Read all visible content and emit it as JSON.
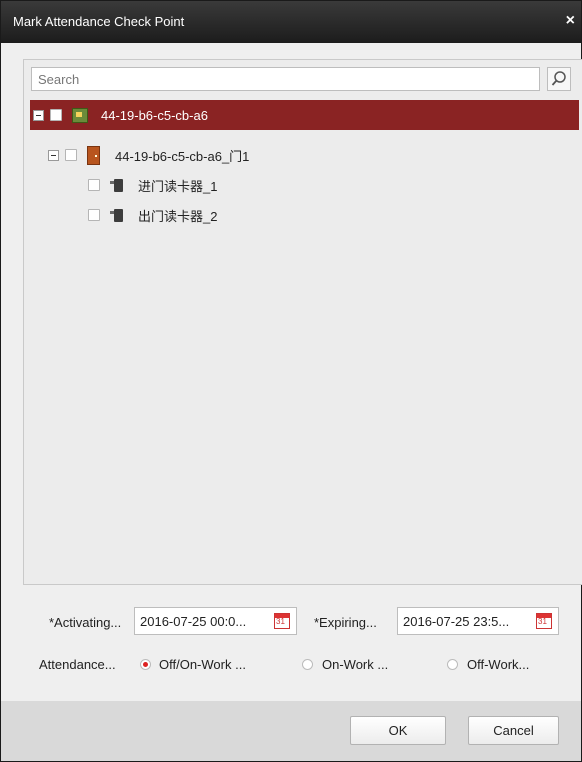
{
  "dialog": {
    "title": "Mark Attendance Check Point",
    "close_symbol": "×"
  },
  "search": {
    "placeholder": "Search",
    "icon": "search-icon"
  },
  "tree": {
    "device": {
      "label": "44-19-b6-c5-cb-a6",
      "icon": "access-device-icon",
      "selected": true,
      "checked": false
    },
    "door": {
      "label": "44-19-b6-c5-cb-a6_门1",
      "icon": "door-icon",
      "checked": false
    },
    "readers": [
      {
        "label": "进门读卡器_1",
        "icon": "card-reader-icon",
        "checked": false
      },
      {
        "label": "出门读卡器_2",
        "icon": "card-reader-icon",
        "checked": false
      }
    ]
  },
  "time": {
    "activating_label": "*Activating...",
    "activating_value": "2016-07-25 00:0...",
    "expiring_label": "*Expiring...",
    "expiring_value": "2016-07-25 23:5..."
  },
  "attendance": {
    "label": "Attendance...",
    "options": [
      {
        "label": "Off/On-Work ...",
        "selected": true
      },
      {
        "label": "On-Work ...",
        "selected": false
      },
      {
        "label": "Off-Work...",
        "selected": false
      }
    ]
  },
  "buttons": {
    "ok": "OK",
    "cancel": "Cancel"
  },
  "colors": {
    "selection": "#8a2323",
    "titlebar": "#262626",
    "radio_selected": "#dd2222"
  }
}
